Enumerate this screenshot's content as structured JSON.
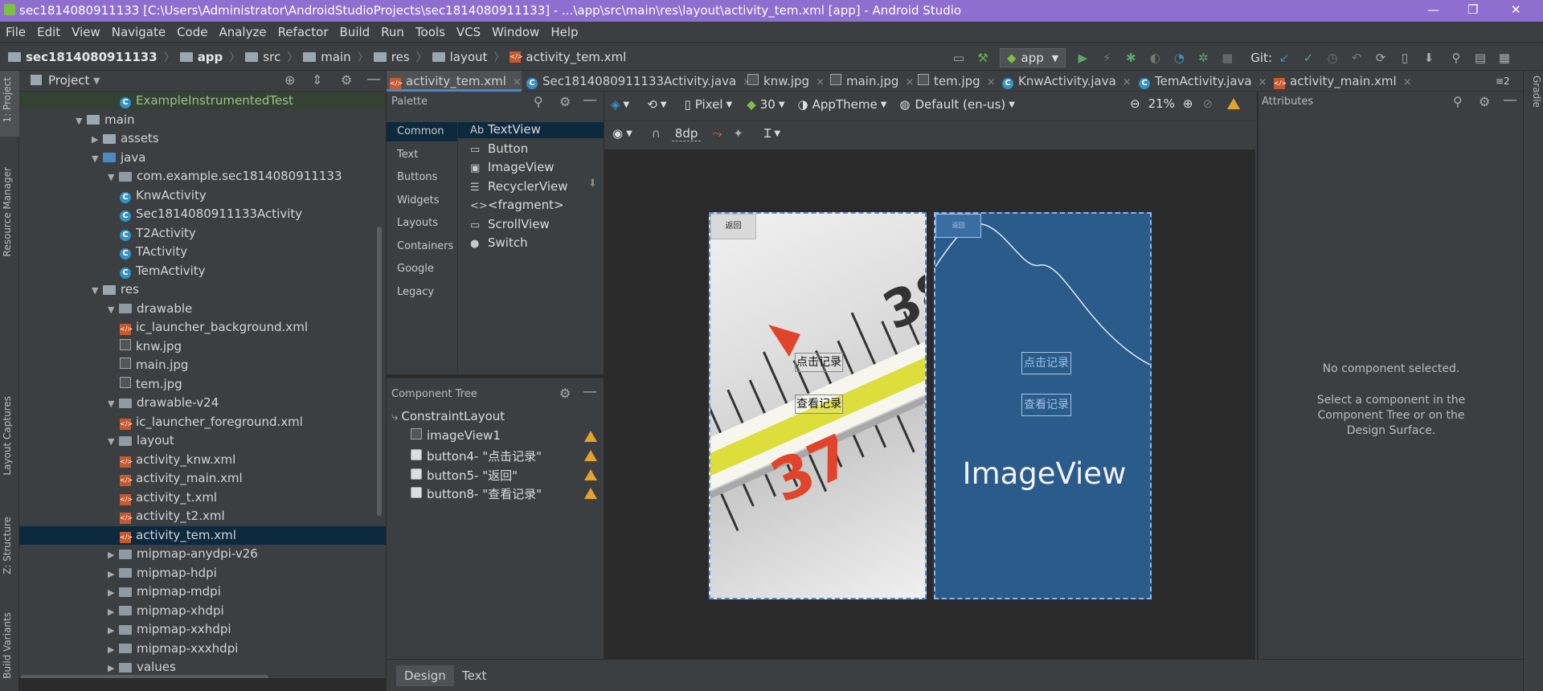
{
  "title_bar": {
    "title": "sec1814080911133 [C:\\Users\\Administrator\\AndroidStudioProjects\\sec1814080911133] - ...\\app\\src\\main\\res\\layout\\activity_tem.xml [app] - Android Studio",
    "minimize": "—",
    "restore": "❐",
    "close": "✕"
  },
  "menu": [
    "File",
    "Edit",
    "View",
    "Navigate",
    "Code",
    "Analyze",
    "Refactor",
    "Build",
    "Run",
    "Tools",
    "VCS",
    "Window",
    "Help"
  ],
  "breadcrumb": [
    "sec1814080911133",
    "app",
    "src",
    "main",
    "res",
    "layout",
    "activity_tem.xml"
  ],
  "run_config": "app",
  "git_label": "Git:",
  "side_labels": {
    "project": "1: Project",
    "resource_manager": "Resource Manager",
    "layout_captures": "Layout Captures",
    "structure": "Z: Structure",
    "build_variants": "Build Variants",
    "gradle": "Gradle"
  },
  "project_panel": {
    "title": "Project",
    "tree": [
      {
        "label": "ExampleInstrumentedTest",
        "kind": "class",
        "depth": 7,
        "arrow": ""
      },
      {
        "label": "main",
        "kind": "folder",
        "depth": 3,
        "arrow": "▼"
      },
      {
        "label": "assets",
        "kind": "folder",
        "depth": 4,
        "arrow": "▶"
      },
      {
        "label": "java",
        "kind": "folder-blue",
        "depth": 4,
        "arrow": "▼"
      },
      {
        "label": "com.example.sec1814080911133",
        "kind": "package",
        "depth": 5,
        "arrow": "▼"
      },
      {
        "label": "KnwActivity",
        "kind": "class",
        "depth": 7,
        "arrow": ""
      },
      {
        "label": "Sec1814080911133Activity",
        "kind": "class",
        "depth": 7,
        "arrow": ""
      },
      {
        "label": "T2Activity",
        "kind": "class",
        "depth": 7,
        "arrow": ""
      },
      {
        "label": "TActivity",
        "kind": "class",
        "depth": 7,
        "arrow": ""
      },
      {
        "label": "TemActivity",
        "kind": "class",
        "depth": 7,
        "arrow": ""
      },
      {
        "label": "res",
        "kind": "folder",
        "depth": 4,
        "arrow": "▼"
      },
      {
        "label": "drawable",
        "kind": "package",
        "depth": 5,
        "arrow": "▼"
      },
      {
        "label": "ic_launcher_background.xml",
        "kind": "xml",
        "depth": 7,
        "arrow": ""
      },
      {
        "label": "knw.jpg",
        "kind": "img",
        "depth": 7,
        "arrow": ""
      },
      {
        "label": "main.jpg",
        "kind": "img",
        "depth": 7,
        "arrow": ""
      },
      {
        "label": "tem.jpg",
        "kind": "img",
        "depth": 7,
        "arrow": ""
      },
      {
        "label": "drawable-v24",
        "kind": "package",
        "depth": 5,
        "arrow": "▼"
      },
      {
        "label": "ic_launcher_foreground.xml",
        "kind": "xml",
        "depth": 7,
        "arrow": ""
      },
      {
        "label": "layout",
        "kind": "package",
        "depth": 5,
        "arrow": "▼"
      },
      {
        "label": "activity_knw.xml",
        "kind": "xml",
        "depth": 7,
        "arrow": ""
      },
      {
        "label": "activity_main.xml",
        "kind": "xml",
        "depth": 7,
        "arrow": ""
      },
      {
        "label": "activity_t.xml",
        "kind": "xml",
        "depth": 7,
        "arrow": ""
      },
      {
        "label": "activity_t2.xml",
        "kind": "xml",
        "depth": 7,
        "arrow": ""
      },
      {
        "label": "activity_tem.xml",
        "kind": "xml",
        "depth": 7,
        "arrow": "",
        "selected": true
      },
      {
        "label": "mipmap-anydpi-v26",
        "kind": "package",
        "depth": 5,
        "arrow": "▶"
      },
      {
        "label": "mipmap-hdpi",
        "kind": "package",
        "depth": 5,
        "arrow": "▶"
      },
      {
        "label": "mipmap-mdpi",
        "kind": "package",
        "depth": 5,
        "arrow": "▶"
      },
      {
        "label": "mipmap-xhdpi",
        "kind": "package",
        "depth": 5,
        "arrow": "▶"
      },
      {
        "label": "mipmap-xxhdpi",
        "kind": "package",
        "depth": 5,
        "arrow": "▶"
      },
      {
        "label": "mipmap-xxxhdpi",
        "kind": "package",
        "depth": 5,
        "arrow": "▶"
      },
      {
        "label": "values",
        "kind": "package",
        "depth": 5,
        "arrow": "▶"
      }
    ]
  },
  "tabs": [
    {
      "label": "activity_tem.xml",
      "kind": "xml",
      "active": true
    },
    {
      "label": "Sec1814080911133Activity.java",
      "kind": "class",
      "active": false
    },
    {
      "label": "knw.jpg",
      "kind": "img",
      "active": false
    },
    {
      "label": "main.jpg",
      "kind": "img",
      "active": false
    },
    {
      "label": "tem.jpg",
      "kind": "img",
      "active": false
    },
    {
      "label": "KnwActivity.java",
      "kind": "class",
      "active": false
    },
    {
      "label": "TemActivity.java",
      "kind": "class",
      "active": false
    },
    {
      "label": "activity_main.xml",
      "kind": "xml",
      "active": false
    }
  ],
  "tabs_overflow": "≡2",
  "palette": {
    "title": "Palette",
    "categories": [
      "Common",
      "Text",
      "Buttons",
      "Widgets",
      "Layouts",
      "Containers",
      "Google",
      "Legacy"
    ],
    "items": [
      {
        "icon": "Ab",
        "label": "TextView"
      },
      {
        "icon": "▭",
        "label": "Button"
      },
      {
        "icon": "▣",
        "label": "ImageView"
      },
      {
        "icon": "☰",
        "label": "RecyclerView"
      },
      {
        "icon": "<>",
        "label": "<fragment>"
      },
      {
        "icon": "▭",
        "label": "ScrollView"
      },
      {
        "icon": "●",
        "label": "Switch"
      }
    ]
  },
  "component_tree": {
    "title": "Component Tree",
    "root": "ConstraintLayout",
    "items": [
      "imageView1",
      "button4- \"点击记录\"",
      "button5- \"返回\"",
      "button8- \"查看记录\""
    ]
  },
  "design_toolbar": {
    "device": "Pixel",
    "api": "30",
    "theme": "AppTheme",
    "locale": "Default (en-us)",
    "zoom": "21%",
    "margin": "8dp"
  },
  "preview": {
    "back_button": "返回",
    "record_button": "点击记录",
    "view_records_button": "查看记录",
    "blueprint_back": "返回",
    "imageview_label": "ImageView"
  },
  "attributes": {
    "title": "Attributes",
    "empty_title": "No component selected.",
    "empty_hint": "Select a component in the Component Tree or on the Design Surface."
  },
  "bottom_tabs": [
    "Design",
    "Text"
  ],
  "colors": {
    "accent": "#4a88c7",
    "title_bar": "#8e6fcf",
    "panel": "#3c3f41",
    "editor": "#2b2b2b",
    "warning": "#e3a32d",
    "blueprint": "#2a5b8a"
  }
}
